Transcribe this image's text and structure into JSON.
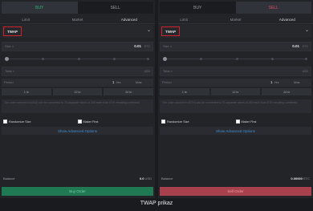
{
  "left": {
    "tabs": {
      "buy": "BUY",
      "sell": "SELL"
    },
    "order_types": [
      "Limit",
      "Market",
      "Advanced"
    ],
    "algo": "TWAP",
    "size": {
      "label": "Size ×",
      "value": "0.01",
      "unit": "ETC"
    },
    "total": {
      "label": "Total ×",
      "unit": "USD"
    },
    "period": {
      "label": "Period",
      "value": "1",
      "hours_unit": "Hrs",
      "minutes_unit": "Mins"
    },
    "presets": [
      "1 hr",
      "12 hr",
      "24 hr"
    ],
    "note": "The order amount in (USD) can be converted to 75 separate slices of 200 each from ETH resulting combined.",
    "randomize_label": "Randomize Size",
    "maker_label": "Maker First",
    "advanced_label": "Show Advanced Options",
    "balance": {
      "label": "Balance",
      "value": "0.0",
      "unit": "USD"
    },
    "action_label": "Buy Order"
  },
  "right": {
    "tabs": {
      "buy": "BUY",
      "sell": "SELL"
    },
    "order_types": [
      "Limit",
      "Market",
      "Advanced"
    ],
    "algo": "TWAP",
    "size": {
      "label": "Size ×",
      "value": "0.01",
      "unit": "ETC"
    },
    "total": {
      "label": "Total ×",
      "unit": "USD"
    },
    "period": {
      "label": "Period",
      "value": "1",
      "hours_unit": "Hrs",
      "minutes_unit": "Mins"
    },
    "presets": [
      "1 hr",
      "12 hr",
      "24 hr"
    ],
    "note": "The order amount in (ETH) can be converted to 75 separate slices of 200 each from ETH resulting combined.",
    "randomize_label": "Randomize Size",
    "maker_label": "Maker First",
    "advanced_label": "Show Advanced Options",
    "balance": {
      "label": "Balance",
      "value": "0.00000",
      "unit": "ETC"
    },
    "action_label": "Sell Order"
  },
  "caption": "TWAP prikaz",
  "colors": {
    "buy": "#29b37a",
    "sell": "#e04b5a",
    "highlight": "#d11f2b",
    "link": "#3f8fd6"
  }
}
